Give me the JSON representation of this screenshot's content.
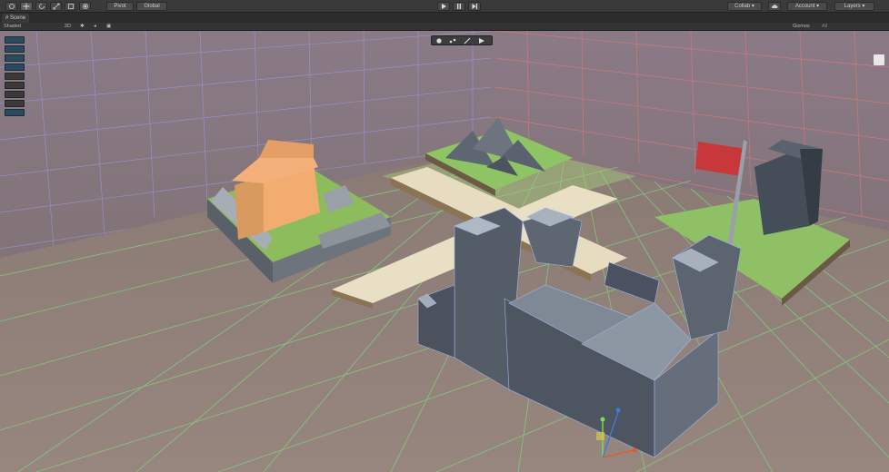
{
  "toolbar": {
    "transform_tools": [
      "hand-tool",
      "move-tool",
      "rotate-tool",
      "scale-tool",
      "rect-tool",
      "transform-tool"
    ],
    "pivot_label": "Pivot",
    "global_label": "Global",
    "collab_label": "Collab",
    "account_label": "Account",
    "layers_label": "Layers"
  },
  "scene_tab": {
    "label": "Scene"
  },
  "scene_bar": {
    "shading_mode": "Shaded",
    "mode_2d": "2D",
    "gizmos_label": "Gizmos",
    "search_placeholder": "All"
  },
  "colors": {
    "floor": "#8c7a74",
    "grid_green": "#7fd47f",
    "grid_red": "#e87878",
    "grid_blue": "#9a9adc",
    "grass": "#8bbd5c",
    "path": "#e6dcbe",
    "stone": "#5f6672",
    "house_wall": "#f2a86e",
    "flag": "#c8383a"
  }
}
